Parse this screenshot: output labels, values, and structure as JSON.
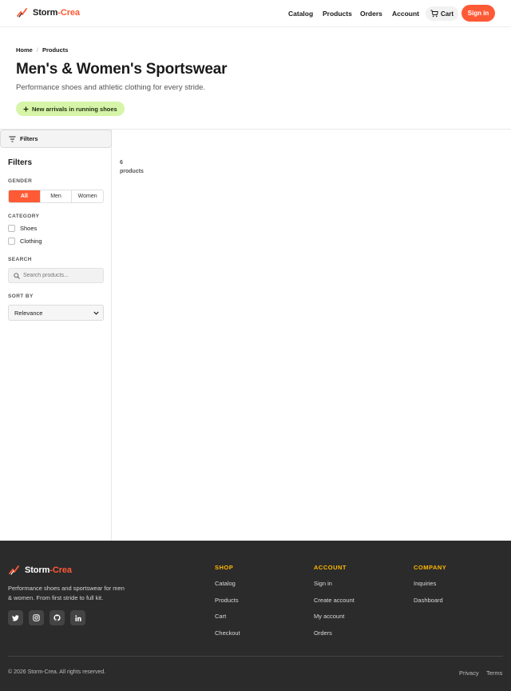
{
  "brand": {
    "part1": "Storm",
    "part2": "-Crea",
    "accent": "#ff5a36"
  },
  "nav": {
    "items": [
      "Catalog",
      "Products",
      "Orders",
      "Account"
    ],
    "cart_label": "Cart",
    "signin_label": "Sign in"
  },
  "breadcrumb": {
    "home": "Home",
    "sep": "/",
    "current": "Products"
  },
  "hero": {
    "title": "Men's & Women's Sportswear",
    "subtitle": "Performance shoes and athletic clothing for every stride.",
    "promo": "New arrivals in running shoes",
    "promo_icon": "plus"
  },
  "sidebar": {
    "toggle_label": "Filters",
    "title": "Filters",
    "gender_label": "GENDER",
    "gender_options": [
      "All",
      "Men",
      "Women"
    ],
    "gender_selected": "All",
    "category_label": "CATEGORY",
    "categories": [
      "Shoes",
      "Clothing"
    ],
    "search_label": "SEARCH",
    "search_placeholder": "Search products...",
    "sort_label": "SORT BY",
    "sort_value": "Relevance"
  },
  "results": {
    "count": "6",
    "count_label": "products"
  },
  "footer": {
    "description": "Performance shoes and sportswear for men & women. From first stride to full kit.",
    "socials": [
      "twitter-icon",
      "instagram-icon",
      "github-icon",
      "linkedin-icon"
    ],
    "columns": [
      {
        "title": "SHOP",
        "links": [
          "Catalog",
          "Products",
          "Cart",
          "Checkout"
        ]
      },
      {
        "title": "ACCOUNT",
        "links": [
          "Sign in",
          "Create account",
          "My account",
          "Orders"
        ]
      },
      {
        "title": "COMPANY",
        "links": [
          "Inquiries",
          "Dashboard"
        ]
      }
    ],
    "copyright": "© 2026 Storm-Crea. All rights reserved.",
    "legal": [
      "Privacy",
      "Terms"
    ]
  }
}
